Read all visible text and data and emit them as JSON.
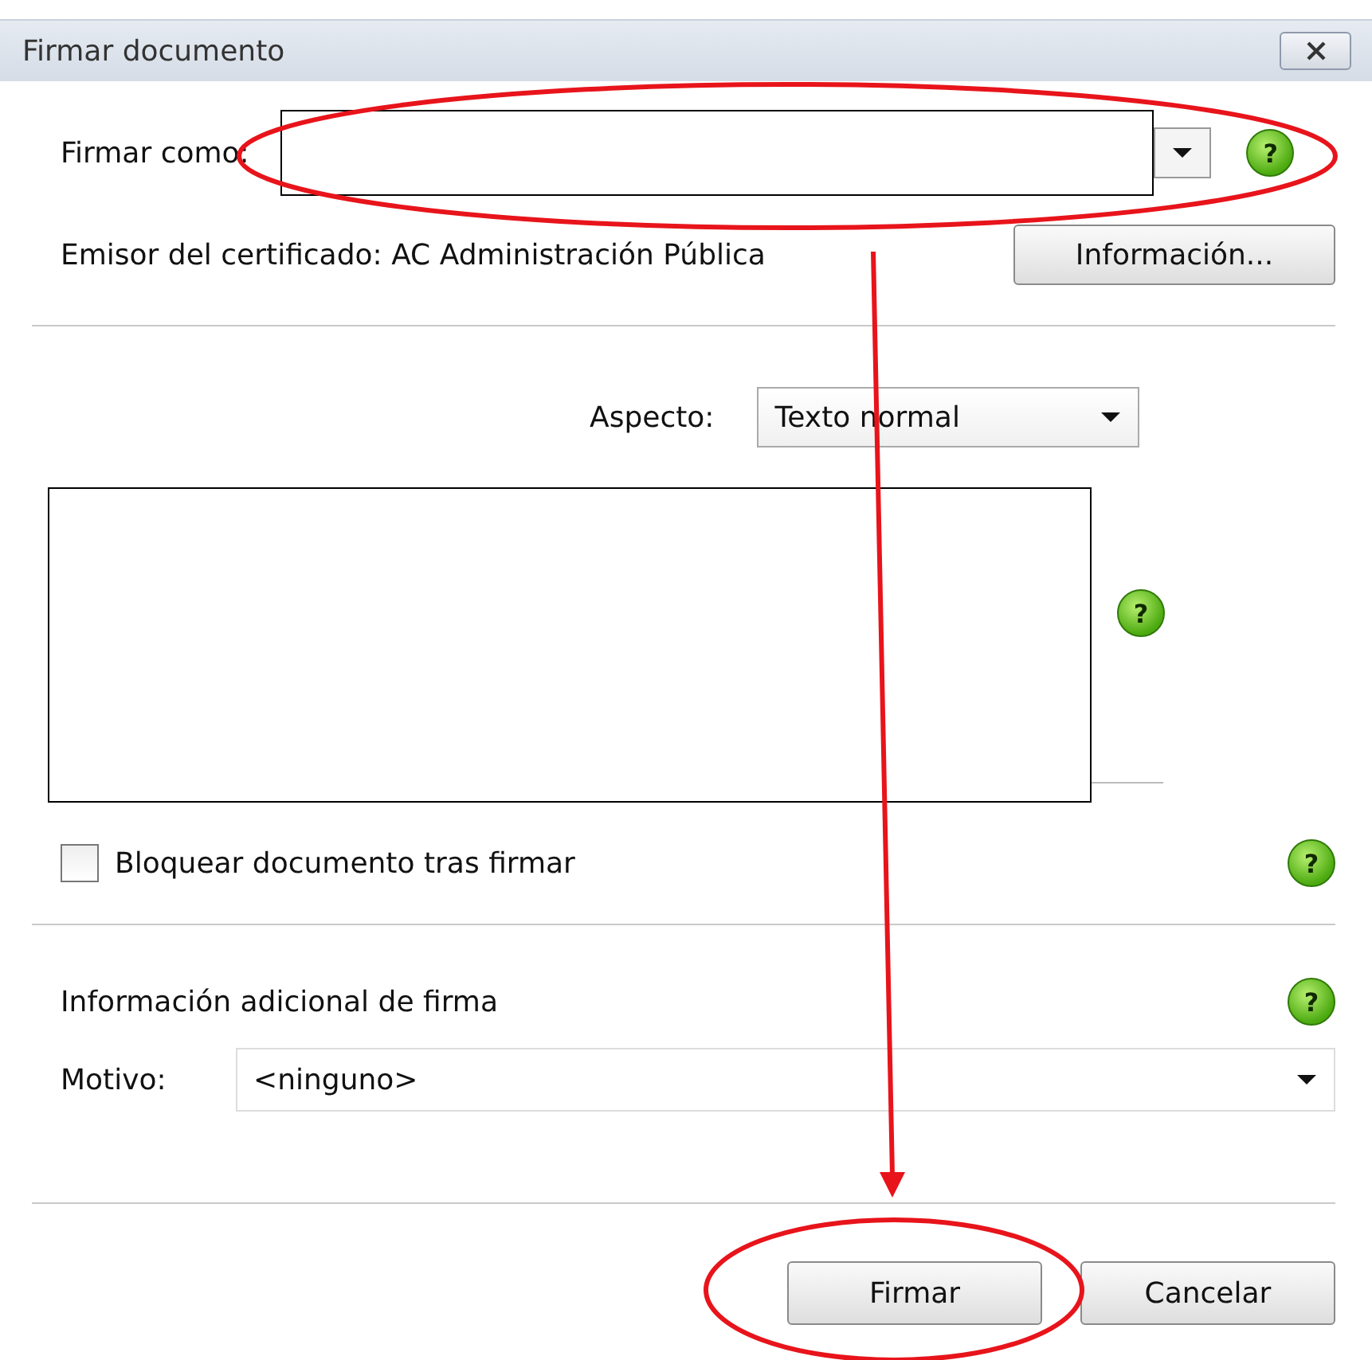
{
  "window": {
    "title": "Firmar documento"
  },
  "sign_as": {
    "label": "Firmar como:",
    "help": "?"
  },
  "issuer": {
    "text": "Emisor del certificado: AC Administración Pública",
    "button": "Información..."
  },
  "appearance": {
    "label": "Aspecto:",
    "value": "Texto normal",
    "help": "?"
  },
  "lock": {
    "label": "Bloquear documento tras firmar",
    "checked": false,
    "help": "?"
  },
  "extra": {
    "title": "Información adicional de firma",
    "help": "?",
    "reason_label": "Motivo:",
    "reason_value": "<ninguno>"
  },
  "buttons": [
    {
      "label": "Firmar"
    },
    {
      "label": "Cancelar"
    }
  ]
}
